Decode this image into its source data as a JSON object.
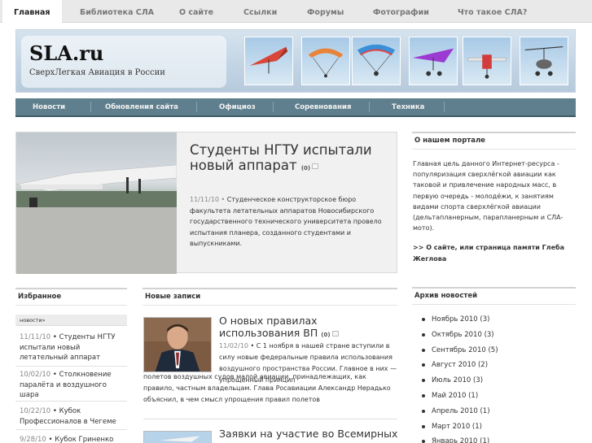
{
  "topnav": {
    "items": [
      "Главная",
      "Библиотека СЛА",
      "О сайте",
      "Ссылки",
      "Форумы",
      "Фотографии",
      "Что такое СЛА?"
    ]
  },
  "header": {
    "title": "SLA.ru",
    "tagline": "СверхЛегкая Авиация в России"
  },
  "catnav": {
    "items": [
      "Новости",
      "Обновления сайта",
      "Официоз",
      "Соревнования",
      "Техника"
    ]
  },
  "featured": {
    "title": "Студенты НГТУ испытали новый аппарат",
    "comments": "(0)",
    "date": "11/11/10",
    "bullet": "•",
    "text": "Студенческое конструкторское бюро факультета летательных аппаратов Новосибирского государственного технического университета провело испытания планера, созданного студентами и выпускниками."
  },
  "about": {
    "heading": "О нашем портале",
    "text": "Главная цель данного Интернет-ресурса - популяризация сверхлёгкой авиации как таковой и привлечение народных масс, в первую очередь - молодёжи, к занятиям видами спорта сверхлёгкой авиации (дельтапланерным, парапланерным и СЛА-мото).",
    "link": ">> О сайте, или страница памяти Глеба Жеглова"
  },
  "favorites": {
    "heading": "Избранное",
    "tab": "новости»",
    "items": [
      {
        "date": "11/11/10",
        "text": "Студенты НГТУ испытали новый летательный аппарат"
      },
      {
        "date": "10/02/10",
        "text": "Столкновение паралёта и воздушного шара"
      },
      {
        "date": "10/22/10",
        "text": "Кубок Профессионалов в Чегеме"
      },
      {
        "date": "9/28/10",
        "text": "Кубок Гриненко 2010"
      }
    ]
  },
  "new_posts": {
    "heading": "Новые записи",
    "posts": [
      {
        "title": "О новых правилах использования ВП",
        "comments": "(0)",
        "date": "11/02/10",
        "text_a": "С 1 ноября в нашей стране вступили в силу новые федеральные правила использования воздушного пространства России. Главное в них — упрощенный принцип",
        "text_b": "полетов воздушных судов малой авиации, принадлежащих, как правило, частным владельцам. Глава Росавиации Александр Нерадько объяснил, в чем смысл упрощения правил полетов"
      },
      {
        "title": "Заявки на участие во Всемирных"
      }
    ]
  },
  "archive": {
    "heading": "Архив новостей",
    "items": [
      "Ноябрь 2010 (3)",
      "Октябрь 2010 (3)",
      "Сентябрь 2010 (5)",
      "Август 2010 (2)",
      "Июль 2010 (3)",
      "Май 2010 (1)",
      "Апрель 2010 (1)",
      "Март 2010 (1)",
      "Январь 2010 (1)"
    ]
  },
  "colors": {
    "catnav_bg": "#5f7f8e",
    "topnav_bg": "#e9e9e9"
  }
}
